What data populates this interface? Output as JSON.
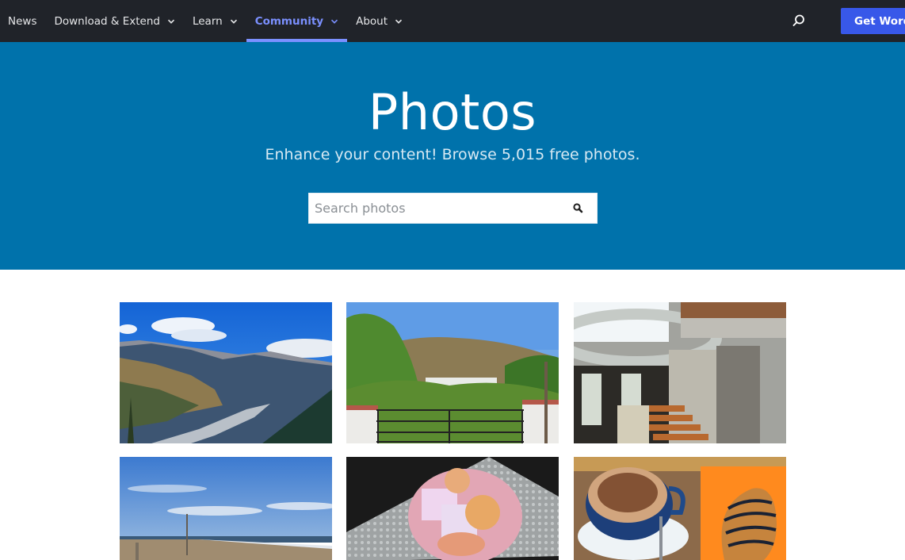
{
  "nav": {
    "items": [
      {
        "label": "News",
        "has_dropdown": false,
        "active": false
      },
      {
        "label": "Download & Extend",
        "has_dropdown": true,
        "active": false
      },
      {
        "label": "Learn",
        "has_dropdown": true,
        "active": false
      },
      {
        "label": "Community",
        "has_dropdown": true,
        "active": true
      },
      {
        "label": "About",
        "has_dropdown": true,
        "active": false
      }
    ],
    "search_icon": "search-icon",
    "cta_label": "Get WordPress"
  },
  "colors": {
    "topbar": "#202329",
    "accent_nav": "#7b90ff",
    "cta": "#3858e9",
    "hero": "#0072ab"
  },
  "hero": {
    "title": "Photos",
    "subtitle": "Enhance your content! Browse 5,015 free photos.",
    "search": {
      "placeholder": "Search photos",
      "value": "",
      "button_icon": "search-icon"
    }
  },
  "photos": [
    {
      "alt": "Snow-capped mountain valley under blue sky with clouds"
    },
    {
      "alt": "Garden gate with flowering trees and green hill behind"
    },
    {
      "alt": "Interior staircase with brick walls and curved concrete balcony"
    },
    {
      "alt": "Beach shoreline with blue sky and wispy clouds"
    },
    {
      "alt": "Pink jelly dessert with fruit pieces on textured glass plate"
    },
    {
      "alt": "Cappuccino in blue cup beside chocolate-drizzled pastry on orange napkin"
    }
  ]
}
